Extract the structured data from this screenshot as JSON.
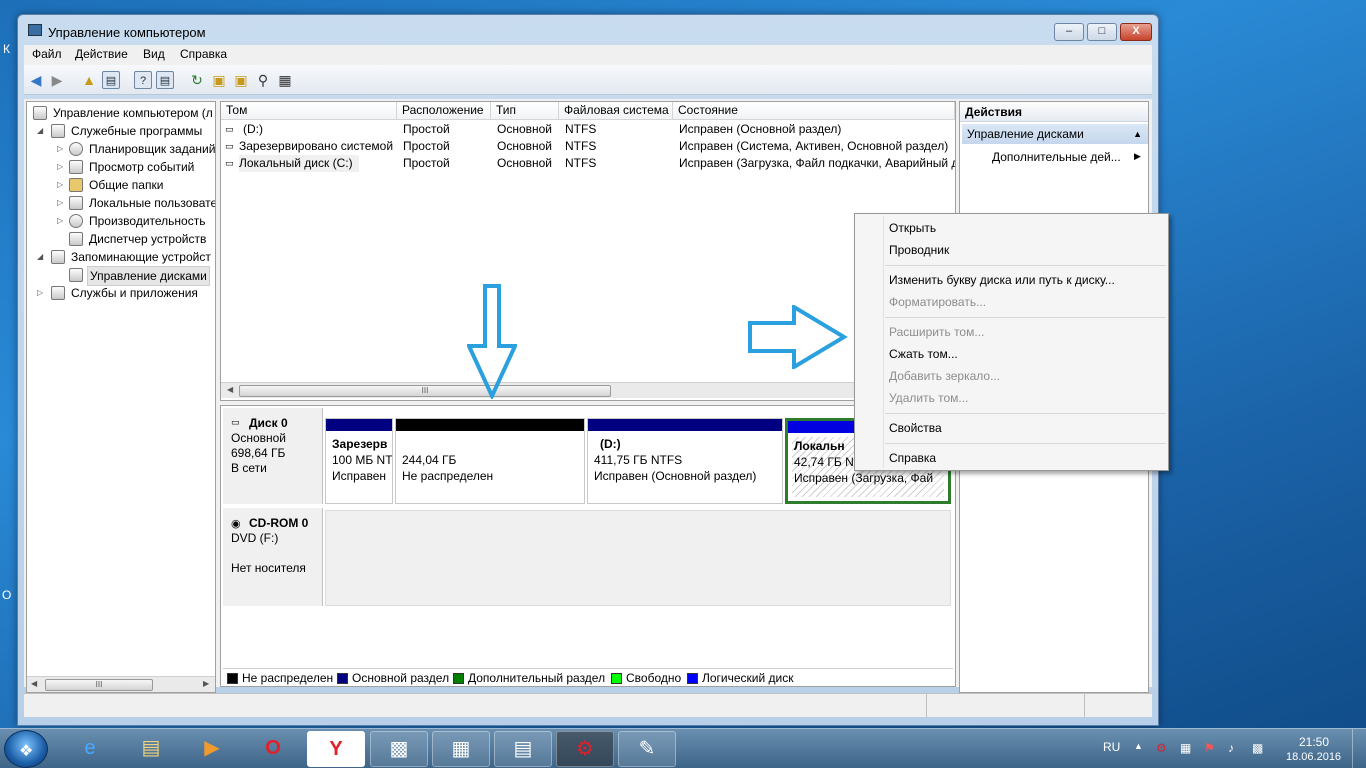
{
  "window": {
    "title": "Управление компьютером",
    "min": "–",
    "max": "□",
    "close": "X"
  },
  "menu": [
    "Файл",
    "Действие",
    "Вид",
    "Справка"
  ],
  "toolbar": {
    "back_icon": "arrow-left-icon",
    "forward_icon": "arrow-right-icon"
  },
  "tree": {
    "items": [
      {
        "label": "Управление компьютером (л",
        "icon": "computer-icon"
      },
      {
        "label": "Служебные программы",
        "icon": "tools-icon"
      },
      {
        "label": "Планировщик заданий",
        "icon": "clock-icon"
      },
      {
        "label": "Просмотр событий",
        "icon": "event-viewer-icon"
      },
      {
        "label": "Общие папки",
        "icon": "shared-folder-icon"
      },
      {
        "label": "Локальные пользовате",
        "icon": "users-icon"
      },
      {
        "label": "Производительность",
        "icon": "performance-icon"
      },
      {
        "label": "Диспетчер устройств",
        "icon": "device-manager-icon"
      },
      {
        "label": "Запоминающие устройст",
        "icon": "storage-icon"
      },
      {
        "label": "Управление дисками",
        "icon": "disk-management-icon"
      },
      {
        "label": "Службы и приложения",
        "icon": "services-icon"
      }
    ],
    "scroll_thumb": "III"
  },
  "volumes": {
    "headers": [
      "Том",
      "Расположение",
      "Тип",
      "Файловая система",
      "Состояние"
    ],
    "rows": [
      [
        "(D:)",
        "Простой",
        "Основной",
        "NTFS",
        "Исправен (Основной раздел)"
      ],
      [
        "Зарезервировано системой",
        "Простой",
        "Основной",
        "NTFS",
        "Исправен (Система, Активен, Основной раздел)"
      ],
      [
        "Локальный диск (C:)",
        "Простой",
        "Основной",
        "NTFS",
        "Исправен (Загрузка, Файл подкачки, Аварийный д"
      ]
    ],
    "scroll_thumb": "III"
  },
  "disks": {
    "disk0": {
      "name": "Диск 0",
      "type": "Основной",
      "size": "698,64 ГБ",
      "status": "В сети",
      "partitions": [
        {
          "title": "Зарезерв",
          "line2": "100 МБ NT",
          "line3": "Исправен"
        },
        {
          "title": "",
          "line2": "244,04 ГБ",
          "line3": "Не распределен"
        },
        {
          "title": "(D:)",
          "line2": "411,75 ГБ NTFS",
          "line3": "Исправен (Основной раздел)"
        },
        {
          "title": "Локальн",
          "line2": "42,74 ГБ N",
          "line3": "Исправен (Загрузка, Фай"
        }
      ]
    },
    "cdrom0": {
      "name": "CD-ROM 0",
      "type": "DVD (F:)",
      "status": "Нет носителя"
    }
  },
  "legend": [
    {
      "label": "Не распределен",
      "color": "#000000"
    },
    {
      "label": "Основной раздел",
      "color": "#000080"
    },
    {
      "label": "Дополнительный раздел",
      "color": "#008000"
    },
    {
      "label": "Свободно",
      "color": "#00ff00"
    },
    {
      "label": "Логический диск",
      "color": "#0000ff"
    }
  ],
  "actions": {
    "title": "Действия",
    "section": "Управление дисками",
    "more": "Дополнительные дей..."
  },
  "context_menu": [
    {
      "label": "Открыть",
      "enabled": true
    },
    {
      "label": "Проводник",
      "enabled": true
    },
    {
      "label": "Изменить букву диска или путь к диску...",
      "enabled": true
    },
    {
      "label": "Форматировать...",
      "enabled": false
    },
    {
      "label": "Расширить том...",
      "enabled": false
    },
    {
      "label": "Сжать том...",
      "enabled": true
    },
    {
      "label": "Добавить зеркало...",
      "enabled": false
    },
    {
      "label": "Удалить том...",
      "enabled": false
    },
    {
      "label": "Свойства",
      "enabled": true
    },
    {
      "label": "Справка",
      "enabled": true
    }
  ],
  "taskbar": {
    "apps": [
      "ie-icon",
      "explorer-icon",
      "media-player-icon",
      "opera-icon",
      "yandex-icon",
      "computer-icon",
      "control-panel-icon",
      "winrar-icon",
      "game-icon",
      "paint-icon"
    ],
    "lang": "RU",
    "time": "21:50",
    "date": "18.06.2016"
  },
  "desktop_edge": {
    "left_k": "К",
    "left_o": "О"
  }
}
